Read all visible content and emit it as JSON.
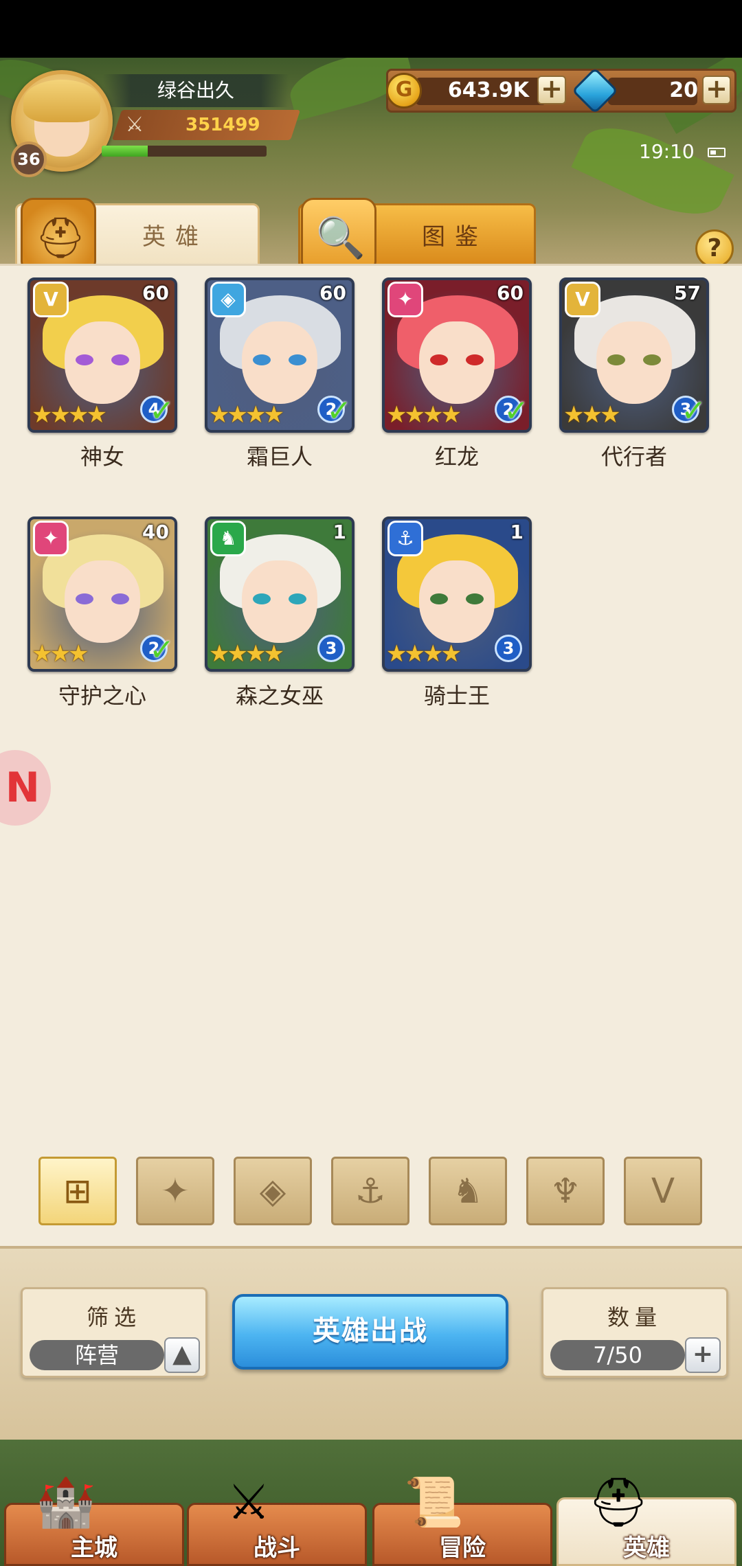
{
  "player": {
    "name": "绿谷出久",
    "level": "36",
    "power": "351499",
    "xp_fraction": 0.28
  },
  "currency": {
    "gold": "643.9K",
    "gems": "20"
  },
  "status": {
    "time": "19:10"
  },
  "tabs": {
    "heroes": "英雄",
    "codex": "图鉴"
  },
  "heroes": [
    {
      "name": "神女",
      "level": "60",
      "stars": "★★★★",
      "count": "4",
      "faction_icon": "claw-icon",
      "faction_glyph": "V",
      "faction_color": "#e3b43a",
      "hair": "#f2cf4c",
      "eye": "#a35bd6",
      "bg": "#6d3a2a"
    },
    {
      "name": "霜巨人",
      "level": "60",
      "stars": "★★★★",
      "count": "2",
      "faction_icon": "diamond-icon",
      "faction_glyph": "◈",
      "faction_color": "#3fa6e0",
      "hair": "#d9dde3",
      "eye": "#3b8fd1",
      "bg": "#4d5f86"
    },
    {
      "name": "红龙",
      "level": "60",
      "stars": "★★★★",
      "count": "2",
      "faction_icon": "flame-icon",
      "faction_glyph": "✦",
      "faction_color": "#e0467a",
      "hair": "#ef5f6a",
      "eye": "#cf2a2a",
      "bg": "#7a1e2a"
    },
    {
      "name": "代行者",
      "level": "57",
      "stars": "★★★",
      "count": "3",
      "faction_icon": "claw-icon",
      "faction_glyph": "V",
      "faction_color": "#e3b43a",
      "hair": "#e9e6e2",
      "eye": "#7c8a3a",
      "bg": "#3a3a3a"
    },
    {
      "name": "守护之心",
      "level": "40",
      "stars": "★★★",
      "count": "2",
      "faction_icon": "flame-icon",
      "faction_glyph": "✦",
      "faction_color": "#e0467a",
      "hair": "#f1e09a",
      "eye": "#8a6bd6",
      "bg": "#c9a86b"
    },
    {
      "name": "森之女巫",
      "level": "1",
      "stars": "★★★★",
      "count": "3",
      "faction_icon": "beast-icon",
      "faction_glyph": "♞",
      "faction_color": "#2aa84a",
      "hair": "#f0efe8",
      "eye": "#2ea6b9",
      "bg": "#3e7a3a"
    },
    {
      "name": "骑士王",
      "level": "1",
      "stars": "★★★★",
      "count": "3",
      "faction_icon": "anchor-icon",
      "faction_glyph": "⚓",
      "faction_color": "#2f6fd6",
      "hair": "#f4c83a",
      "eye": "#3f7a3a",
      "bg": "#2a4a8a"
    }
  ],
  "filters": [
    {
      "name": "filter-all-icon",
      "glyph": "⊞",
      "active": true
    },
    {
      "name": "filter-flame-icon",
      "glyph": "✦",
      "active": false
    },
    {
      "name": "filter-diamond-icon",
      "glyph": "◈",
      "active": false
    },
    {
      "name": "filter-anchor-icon",
      "glyph": "⚓",
      "active": false
    },
    {
      "name": "filter-beast-icon",
      "glyph": "♞",
      "active": false
    },
    {
      "name": "filter-demon-icon",
      "glyph": "♆",
      "active": false
    },
    {
      "name": "filter-claw-icon",
      "glyph": "V",
      "active": false
    }
  ],
  "controls": {
    "filter_title": "筛选",
    "filter_value": "阵营",
    "deploy_label": "英雄出战",
    "count_title": "数量",
    "count_value": "7/50"
  },
  "nav": [
    {
      "label": "主城",
      "icon": "castle-icon",
      "glyph": "🏰"
    },
    {
      "label": "战斗",
      "icon": "crossed-swords-icon",
      "glyph": "⚔"
    },
    {
      "label": "冒险",
      "icon": "scroll-icon",
      "glyph": "📜"
    },
    {
      "label": "英雄",
      "icon": "helmet-icon",
      "glyph": "⛑",
      "active": true
    }
  ]
}
